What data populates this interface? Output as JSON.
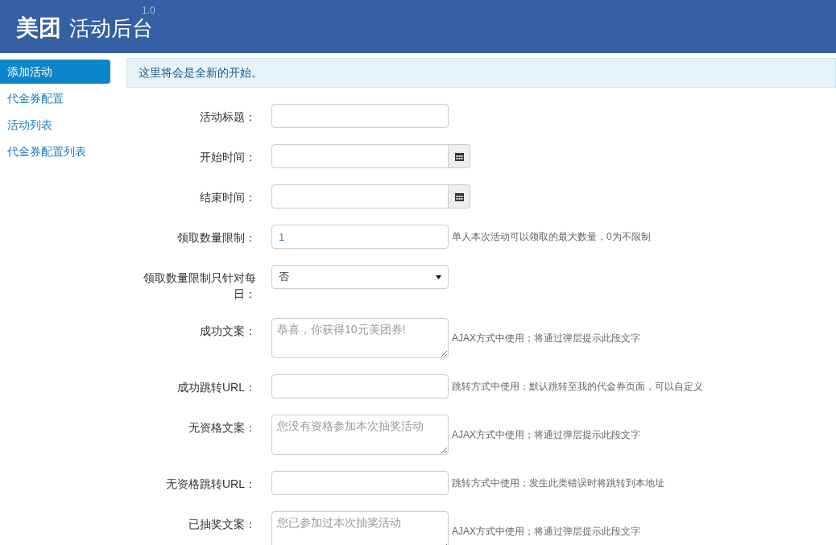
{
  "header": {
    "logo": "美团",
    "title": "活动后台",
    "version": "1.0"
  },
  "sidebar": {
    "items": [
      {
        "label": "添加活动",
        "selected": true
      },
      {
        "label": "代金券配置",
        "selected": false
      },
      {
        "label": "活动列表",
        "selected": false
      },
      {
        "label": "代金券配置列表",
        "selected": false
      }
    ]
  },
  "alert": "这里将会是全新的开始。",
  "form": {
    "fields": [
      {
        "kind": "text",
        "label": "活动标题："
      },
      {
        "kind": "date",
        "label": "开始时间："
      },
      {
        "kind": "date",
        "label": "结束时间："
      },
      {
        "kind": "text",
        "label": "领取数量限制：",
        "value": "1",
        "help": "单人本次活动可以领取的最大数量，0为不限制"
      },
      {
        "kind": "select",
        "label": "领取数量限制只针对每日：",
        "value": "否"
      },
      {
        "kind": "textarea",
        "label": "成功文案：",
        "placeholder": "恭喜，你获得10元美团券!",
        "help": "AJAX方式中使用；将通过弹层提示此段文字"
      },
      {
        "kind": "text",
        "label": "成功跳转URL：",
        "help": "跳转方式中使用；默认跳转至我的代金券页面，可以自定义"
      },
      {
        "kind": "textarea",
        "label": "无资格文案：",
        "placeholder": "您没有资格参加本次抽奖活动",
        "help": "AJAX方式中使用；将通过弹层提示此段文字"
      },
      {
        "kind": "text",
        "label": "无资格跳转URL：",
        "help": "跳转方式中使用；发生此类错误时将跳转到本地址"
      },
      {
        "kind": "textarea",
        "label": "已抽奖文案：",
        "placeholder": "您已参加过本次抽奖活动",
        "help": "AJAX方式中使用；将通过弹层提示此段文字"
      }
    ]
  }
}
